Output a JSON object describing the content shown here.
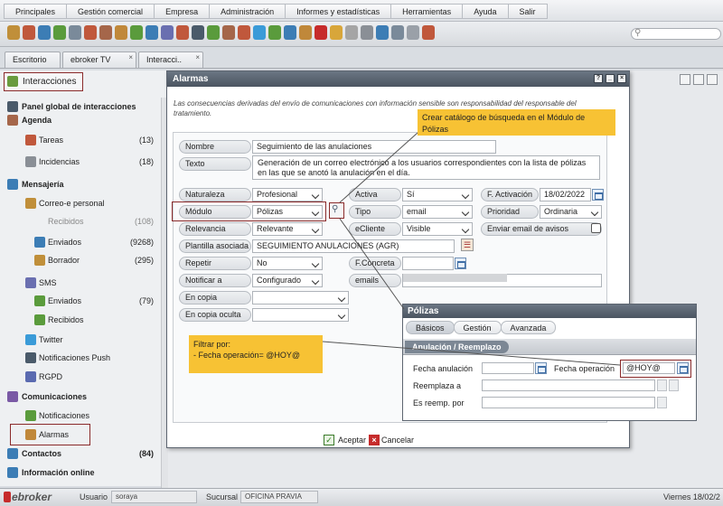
{
  "menu": [
    "Principales",
    "Gestión comercial",
    "Empresa",
    "Administración",
    "Informes y estadísticas",
    "Herramientas",
    "Ayuda",
    "Salir"
  ],
  "tabs": [
    {
      "label": "Escritorio"
    },
    {
      "label": "ebroker TV"
    },
    {
      "label": "Interacci.."
    }
  ],
  "sidebar": {
    "header": "Interacciones",
    "items": [
      {
        "label": "Panel global de interacciones",
        "count": ""
      },
      {
        "label": "Agenda",
        "count": ""
      },
      {
        "label": "Tareas",
        "count": "(13)"
      },
      {
        "label": "Incidencias",
        "count": "(18)"
      },
      {
        "label": "Mensajería",
        "count": ""
      },
      {
        "label": "Correo-e personal",
        "count": ""
      },
      {
        "label": "Recibidos",
        "count": "(108)"
      },
      {
        "label": "Enviados",
        "count": "(9268)"
      },
      {
        "label": "Borrador",
        "count": "(295)"
      },
      {
        "label": "SMS",
        "count": ""
      },
      {
        "label": "Enviados",
        "count": "(79)"
      },
      {
        "label": "Recibidos",
        "count": ""
      },
      {
        "label": "Twitter",
        "count": ""
      },
      {
        "label": "Notificaciones Push",
        "count": ""
      },
      {
        "label": "RGPD",
        "count": ""
      },
      {
        "label": "Comunicaciones",
        "count": ""
      },
      {
        "label": "Notificaciones",
        "count": ""
      },
      {
        "label": "Alarmas",
        "count": ""
      },
      {
        "label": "Contactos",
        "count": "(84)"
      },
      {
        "label": "Información online",
        "count": ""
      }
    ]
  },
  "dialog": {
    "title": "Alarmas",
    "notice": "Las consecuencias derivadas del envío de comunicaciones con información sensible son responsabilidad del responsable del tratamiento.",
    "fields": {
      "nombre": {
        "label": "Nombre",
        "value": "Seguimiento de las anulaciones"
      },
      "texto": {
        "label": "Texto",
        "value": "Generación de un correo electrónico a los usuarios correspondientes con la lista de pólizas en las que se anotó la anulación en el día."
      },
      "naturaleza": {
        "label": "Naturaleza",
        "value": "Profesional"
      },
      "activa": {
        "label": "Activa",
        "value": "Sí"
      },
      "f_activacion": {
        "label": "F. Activación",
        "value": "18/02/2022"
      },
      "modulo": {
        "label": "Módulo",
        "value": "Pólizas"
      },
      "tipo": {
        "label": "Tipo",
        "value": "email"
      },
      "prioridad": {
        "label": "Prioridad",
        "value": "Ordinaria"
      },
      "relevancia": {
        "label": "Relevancia",
        "value": "Relevante"
      },
      "ecliente": {
        "label": "eCliente",
        "value": "Visible"
      },
      "enviar_email": {
        "label": "Enviar email de avisos"
      },
      "plantilla": {
        "label": "Plantilla asociada",
        "value": "SEGUIMIENTO ANULACIONES (AGR)"
      },
      "repetir": {
        "label": "Repetir",
        "value": "No"
      },
      "f_concreta": {
        "label": "F.Concreta",
        "value": ""
      },
      "notificar": {
        "label": "Notificar a",
        "value": "Configurado"
      },
      "emails": {
        "label": "emails",
        "value": ""
      },
      "en_copia": {
        "label": "En copia",
        "value": ""
      },
      "en_copia_oculta": {
        "label": "En copia oculta",
        "value": ""
      }
    },
    "buttons": {
      "accept": "Aceptar",
      "cancel": "Cancelar"
    }
  },
  "callouts": {
    "catalogo": "Crear catálogo de búsqueda en el Módulo de Pólizas",
    "filtrar_title": "Filtrar por:",
    "filtrar_body": "- Fecha operación= @HOY@"
  },
  "polizas": {
    "title": "Pólizas",
    "tabs": [
      "Básicos",
      "Gestión",
      "Avanzada"
    ],
    "section": "Anulación / Reemplazo",
    "fields": {
      "fecha_anulacion": {
        "label": "Fecha anulación",
        "value": ""
      },
      "fecha_operacion": {
        "label": "Fecha operación",
        "value": "@HOY@"
      },
      "reemplaza_a": {
        "label": "Reemplaza a",
        "value": ""
      },
      "es_reemp_por": {
        "label": "Es reemp. por",
        "value": ""
      }
    }
  },
  "statusbar": {
    "logo": "ebroker",
    "usuario_label": "Usuario",
    "usuario": "soraya",
    "sucursal_label": "Sucursal",
    "sucursal": "OFICINA PRAVIA",
    "date": "Viernes 18/02/2"
  },
  "colors": {
    "highlight": "#8a2a2a",
    "callout": "#f7c234",
    "title_bar": "#5b6571"
  }
}
